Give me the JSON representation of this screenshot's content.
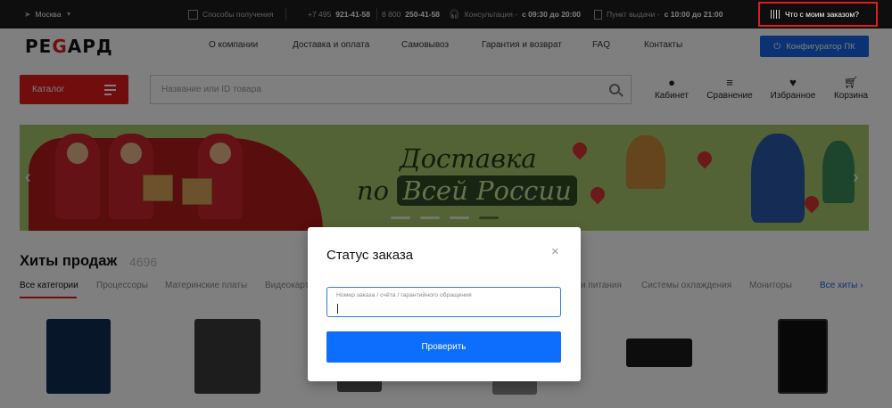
{
  "topbar": {
    "city": "Москва",
    "delivery": "Способы получения",
    "phone1_prefix": "+7 495 ",
    "phone1_main": "921-41-58",
    "phone2_prefix": "8 800 ",
    "phone2_main": "250-41-58",
    "consult_label": "Консультация - ",
    "consult_hours": "с 09:30 до 20:00",
    "pickup_label": "Пункт выдачи - ",
    "pickup_hours": "с 10:00 до 21:00",
    "order_status": "Что с моим заказом?"
  },
  "logo": {
    "part1": "РЕ",
    "part2": "G",
    "part3": "АРД"
  },
  "nav": {
    "links": [
      "О компании",
      "Доставка и оплата",
      "Самовывоз",
      "Гарантия и возврат",
      "FAQ",
      "Контакты"
    ],
    "configurator": "Конфигуратор ПК"
  },
  "search": {
    "catalog": "Каталог",
    "placeholder": "Название или ID товара"
  },
  "user_icons": [
    {
      "label": "Кабинет",
      "icon": "user-icon"
    },
    {
      "label": "Сравнение",
      "icon": "compare-icon"
    },
    {
      "label": "Избранное",
      "icon": "heart-icon"
    },
    {
      "label": "Корзина",
      "icon": "cart-icon"
    }
  ],
  "banner": {
    "line1": "Доставка",
    "line2_prefix": "по",
    "line2_highlight": "Всей России"
  },
  "hits": {
    "title": "Хиты продаж",
    "count": "4696",
    "categories": [
      "Все категории",
      "Процессоры",
      "Материнские платы",
      "Видеокарты",
      "и питания",
      "Системы охлаждения",
      "Мониторы"
    ],
    "all_link": "Все хиты",
    "all_arrow": "›"
  },
  "modal": {
    "title": "Статус заказа",
    "close": "×",
    "field_label": "Номер заказа / счёта / гарантийного обращения",
    "field_value": "",
    "submit": "Проверить"
  },
  "colors": {
    "brand_red": "#e21b1b",
    "blue": "#1565e8",
    "button_blue": "#0d6efd",
    "banner_green": "#a8c66a"
  }
}
